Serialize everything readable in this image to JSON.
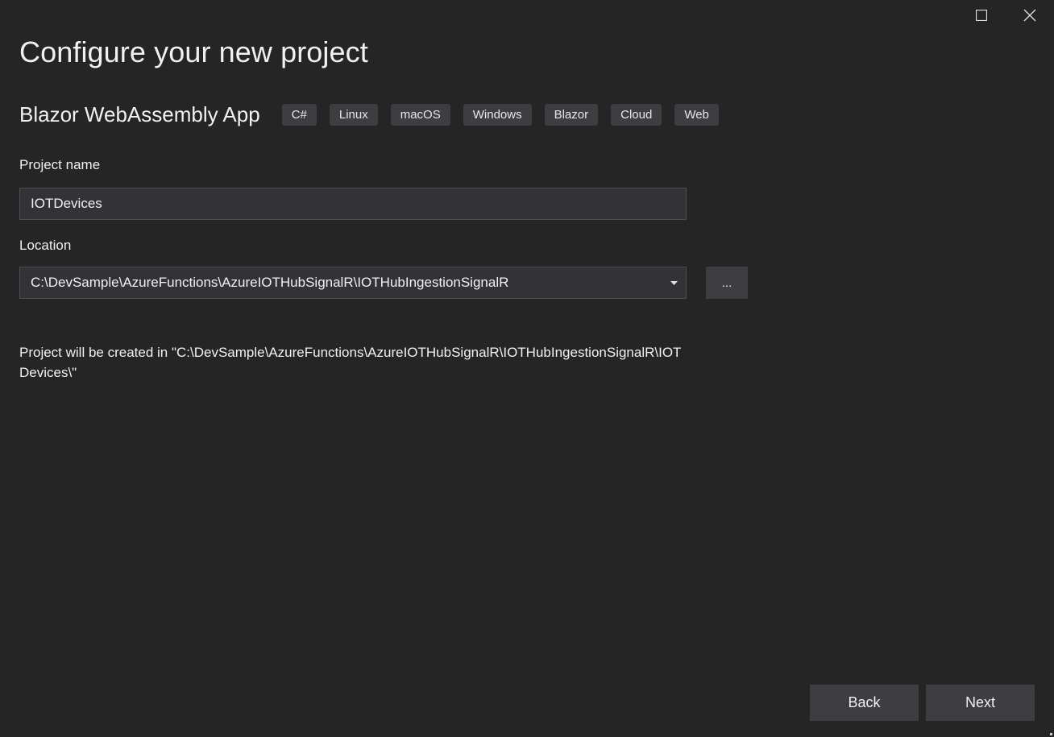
{
  "window": {
    "maximize_icon": "maximize-icon",
    "close_icon": "close-icon"
  },
  "page": {
    "title": "Configure your new project"
  },
  "template": {
    "name": "Blazor WebAssembly App",
    "tags": [
      "C#",
      "Linux",
      "macOS",
      "Windows",
      "Blazor",
      "Cloud",
      "Web"
    ]
  },
  "project_name": {
    "label": "Project name",
    "value": "IOTDevices"
  },
  "location": {
    "label": "Location",
    "value": "C:\\DevSample\\AzureFunctions\\AzureIOTHubSignalR\\IOTHubIngestionSignalR",
    "browse_label": "..."
  },
  "result": {
    "text": "Project will be created in \"C:\\DevSample\\AzureFunctions\\AzureIOTHubSignalR\\IOTHubIngestionSignalR\\IOTDevices\\\""
  },
  "footer": {
    "back_label": "Back",
    "next_label": "Next"
  },
  "colors": {
    "background": "#252526",
    "control": "#3e3e42",
    "input": "#333337",
    "text": "#f1f1f1"
  }
}
